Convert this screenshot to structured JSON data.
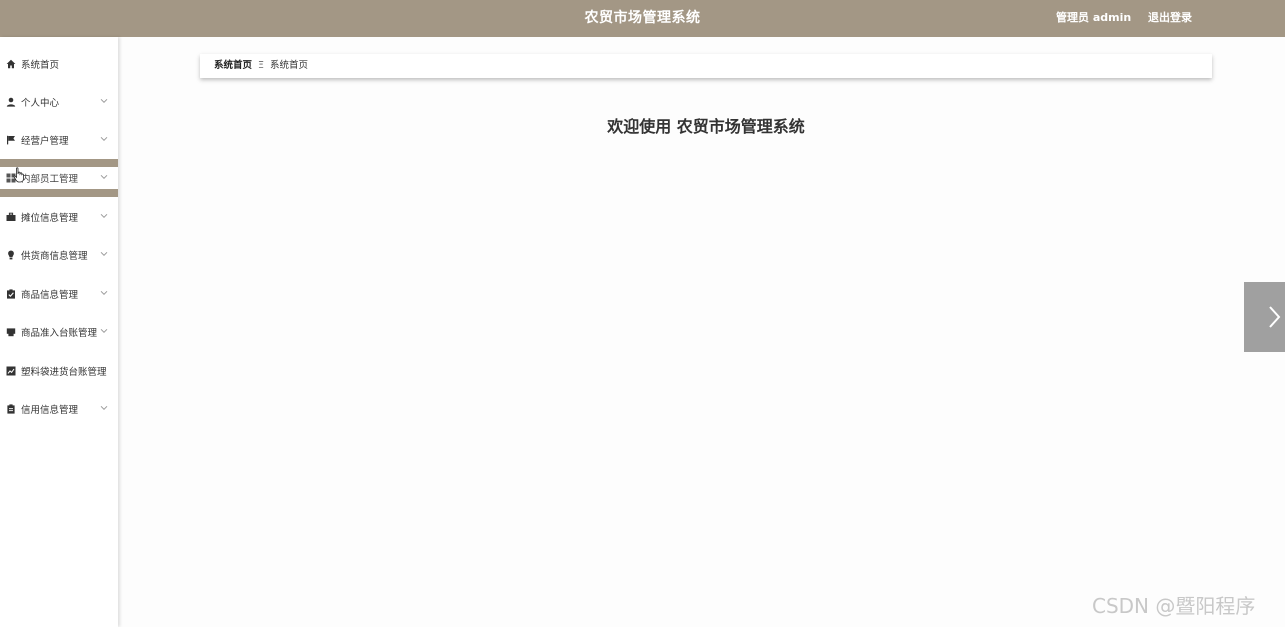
{
  "header": {
    "title": "农贸市场管理系统",
    "user_label": "管理员 admin",
    "logout_label": "退出登录",
    "bg_color": "#a39785"
  },
  "sidebar": {
    "items": [
      {
        "label": "系统首页",
        "icon": "home-icon",
        "has_submenu": false
      },
      {
        "label": "个人中心",
        "icon": "user-icon",
        "has_submenu": true
      },
      {
        "label": "经营户管理",
        "icon": "flag-icon",
        "has_submenu": true
      },
      {
        "label": "内部员工管理",
        "icon": "grid-icon",
        "has_submenu": true,
        "active": true
      },
      {
        "label": "摊位信息管理",
        "icon": "briefcase-icon",
        "has_submenu": true
      },
      {
        "label": "供货商信息管理",
        "icon": "lightbulb-icon",
        "has_submenu": true
      },
      {
        "label": "商品信息管理",
        "icon": "clipboard-check-icon",
        "has_submenu": true
      },
      {
        "label": "商品准入台账管理",
        "icon": "printer-icon",
        "has_submenu": true
      },
      {
        "label": "塑料袋进货台账管理",
        "icon": "chart-icon",
        "has_submenu": false
      },
      {
        "label": "信用信息管理",
        "icon": "clipboard-icon",
        "has_submenu": true
      }
    ]
  },
  "breadcrumb": {
    "home": "系统首页",
    "separator": "Ξ",
    "current": "系统首页"
  },
  "main": {
    "welcome": "欢迎使用 农贸市场管理系统"
  },
  "watermark": "CSDN @暨阳程序"
}
